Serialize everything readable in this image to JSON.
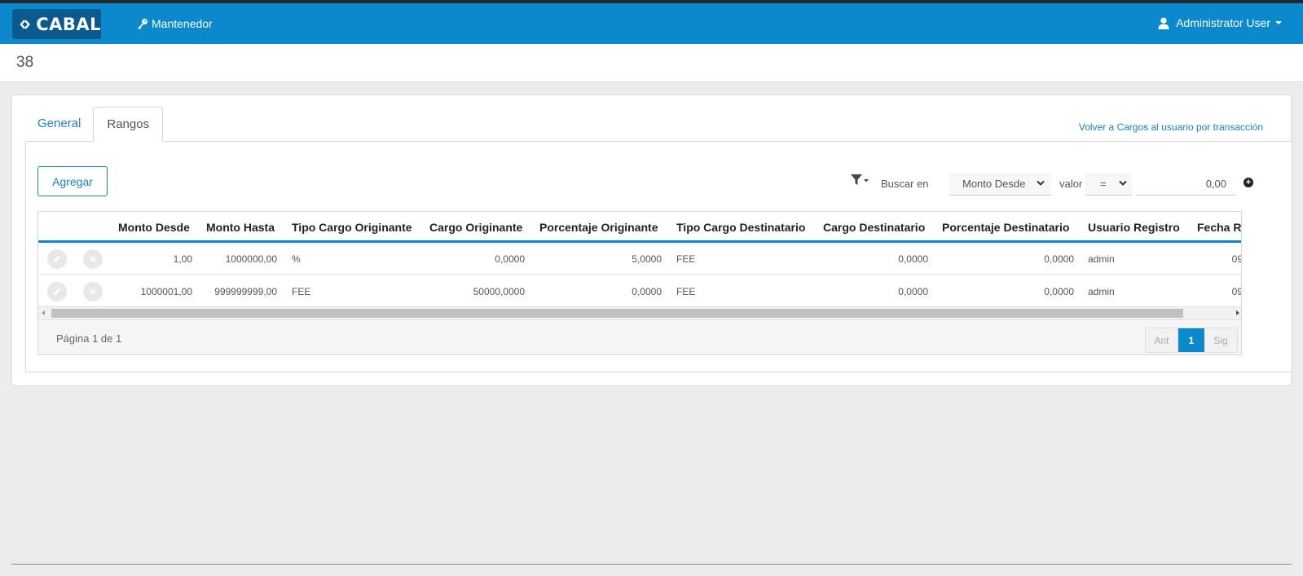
{
  "navbar": {
    "logo_text": "CABAL",
    "nav_link": "Mantenedor",
    "user_label": "Administrator User",
    "bg_color": "#0b89cc"
  },
  "page": {
    "title": "38"
  },
  "tabs": [
    {
      "label": "General",
      "active": false
    },
    {
      "label": "Rangos",
      "active": true
    }
  ],
  "back_link": "Volver a Cargos al usuario por transacción",
  "toolbar": {
    "add_label": "Agregar",
    "search_in_label": "Buscar en",
    "field_selected": "Monto Desde",
    "value_label": "valor",
    "operator_selected": "=",
    "value_input": "0,00"
  },
  "table": {
    "columns": [
      "Monto Desde",
      "Monto Hasta",
      "Tipo Cargo Originante",
      "Cargo Originante",
      "Porcentaje Originante",
      "Tipo Cargo Destinatario",
      "Cargo Destinatario",
      "Porcentaje Destinatario",
      "Usuario Registro",
      "Fecha R"
    ],
    "rows": [
      [
        "1,00",
        "1000000,00",
        "%",
        "0,0000",
        "5,0000",
        "FEE",
        "0,0000",
        "0,0000",
        "admin",
        "09"
      ],
      [
        "1000001,00",
        "999999999,00",
        "FEE",
        "50000,0000",
        "0,0000",
        "FEE",
        "0,0000",
        "0,0000",
        "admin",
        "09"
      ]
    ]
  },
  "pagination": {
    "info": "Página 1 de 1",
    "prev": "Ant",
    "current": "1",
    "next": "Sig"
  }
}
